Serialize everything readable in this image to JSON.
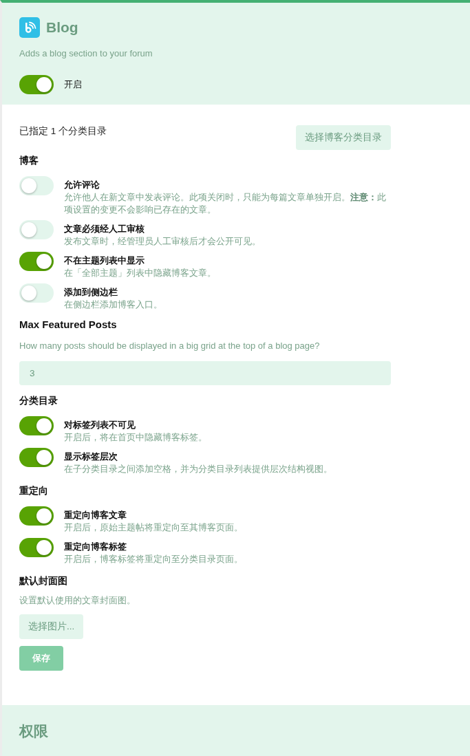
{
  "extension": {
    "title": "Blog",
    "description": "Adds a blog section to your forum",
    "enable_toggle": {
      "label": "开启",
      "on": true
    }
  },
  "categories": {
    "summary": "已指定 1 个分类目录",
    "button": "选择博客分类目录"
  },
  "groups": [
    {
      "kind": "toggles",
      "heading": "博客",
      "items": [
        {
          "label": "允许评论",
          "help": "允许他人在新文章中发表评论。此项关闭时，只能为每篇文章单独开启。**注意：**此项设置的变更不会影响已存在的文章。",
          "on": false
        },
        {
          "label": "文章必须经人工审核",
          "help": "发布文章时，经管理员人工审核后才会公开可见。",
          "on": false
        },
        {
          "label": "不在主题列表中显示",
          "help": "在「全部主题」列表中隐藏博客文章。",
          "on": true
        },
        {
          "label": "添加到侧边栏",
          "help": "在侧边栏添加博客入口。",
          "on": false
        }
      ]
    },
    {
      "kind": "number",
      "heading": "Max Featured Posts",
      "help": "How many posts should be displayed in a big grid at the top of a blog page?",
      "value": "3"
    },
    {
      "kind": "toggles",
      "heading": "分类目录",
      "items": [
        {
          "label": "对标签列表不可见",
          "help": "开启后，将在首页中隐藏博客标签。",
          "on": true
        },
        {
          "label": "显示标签层次",
          "help": "在子分类目录之间添加空格，并为分类目录列表提供层次结构视图。",
          "on": true
        }
      ]
    },
    {
      "kind": "toggles",
      "heading": "重定向",
      "items": [
        {
          "label": "重定向博客文章",
          "help": "开启后，原始主题帖将重定向至其博客页面。",
          "on": true
        },
        {
          "label": "重定向博客标签",
          "help": "开启后，博客标签将重定向至分类目录页面。",
          "on": true
        }
      ]
    },
    {
      "kind": "image",
      "heading": "默认封面图",
      "help": "设置默认使用的文章封面图。",
      "button": "选择图片..."
    }
  ],
  "save_button": {
    "label": "保存",
    "disabled": true
  },
  "next_section": {
    "title": "权限"
  }
}
